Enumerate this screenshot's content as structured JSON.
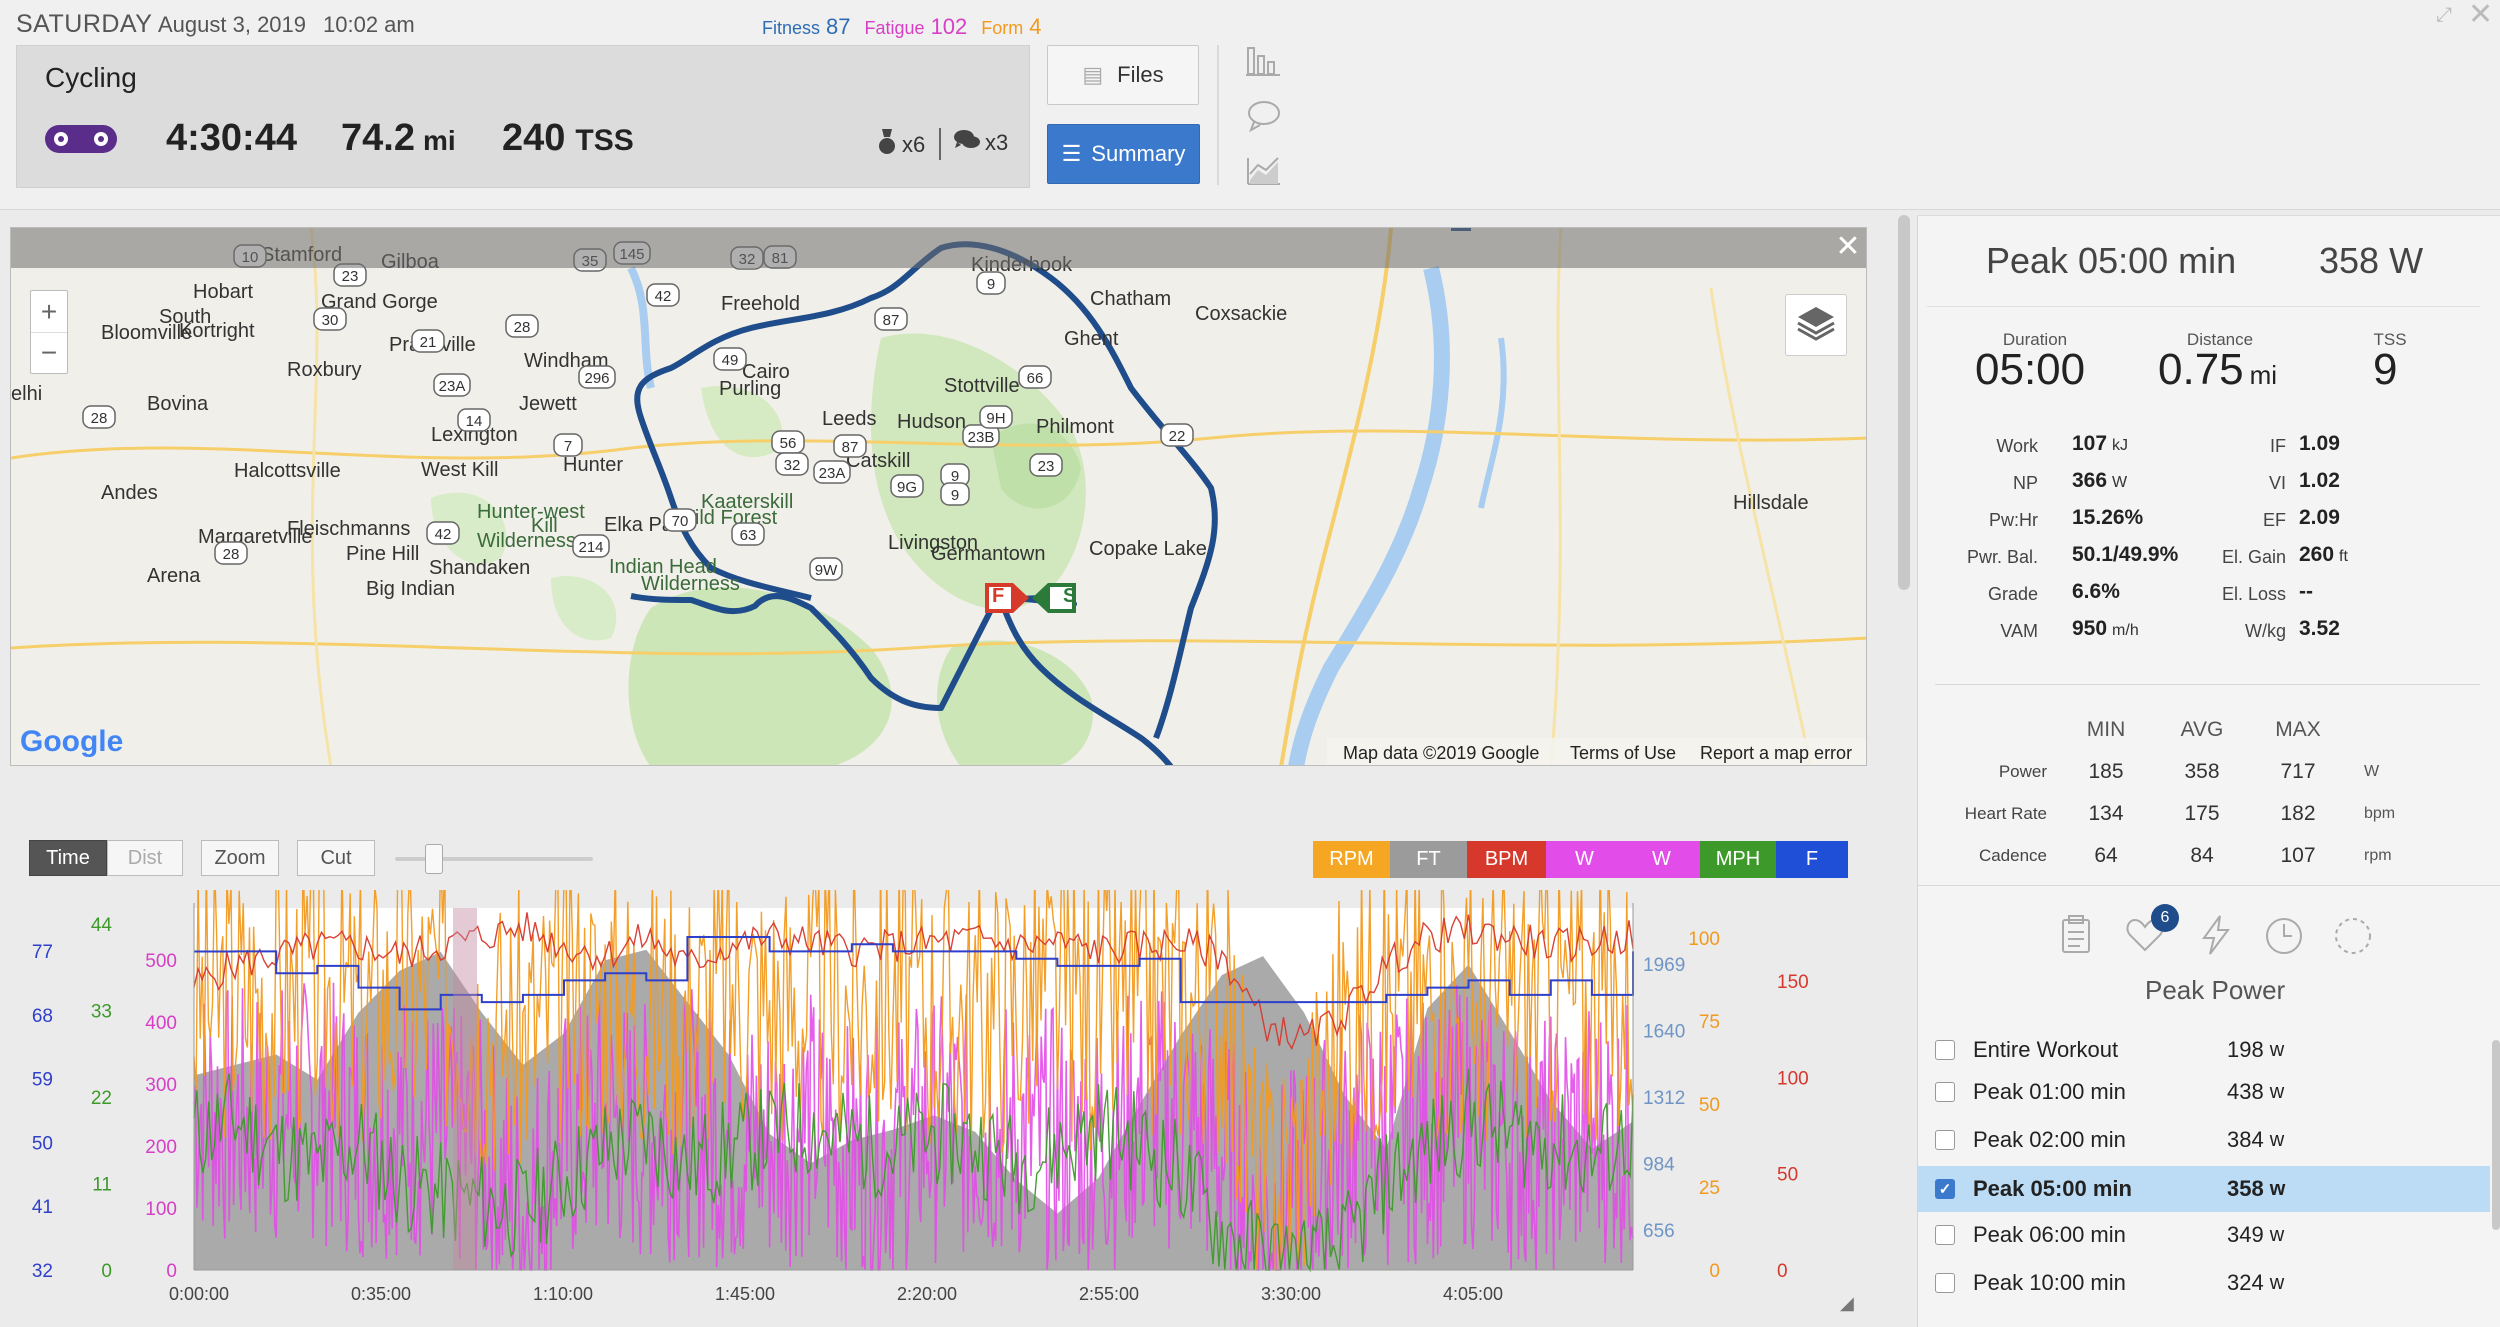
{
  "header": {
    "day": "SATURDAY",
    "date": "August 3, 2019",
    "time": "10:02 am",
    "metrics": [
      {
        "label": "Fitness",
        "value": "87",
        "color": "#2e6db5"
      },
      {
        "label": "Fatigue",
        "value": "102",
        "color": "#d63fc6"
      },
      {
        "label": "Form",
        "value": "4",
        "color": "#f29a1e"
      }
    ]
  },
  "workout": {
    "type": "Cycling",
    "duration": "4:30:44",
    "distance": "74.2",
    "distance_unit": "mi",
    "tss": "240",
    "tss_unit": "TSS",
    "badge_count": "x6",
    "comment_count": "x3"
  },
  "buttons": {
    "files": "Files",
    "summary": "Summary"
  },
  "map": {
    "labels": [
      {
        "t": "Stamford",
        "green": false
      },
      {
        "t": "Gilboa",
        "green": false
      },
      {
        "t": "Kinderhook",
        "green": false
      },
      {
        "t": "Hobart",
        "green": false
      },
      {
        "t": "Grand Gorge",
        "green": false
      },
      {
        "t": "Freehold",
        "green": false
      },
      {
        "t": "Chatham",
        "green": false
      },
      {
        "t": "Coxsackie",
        "green": false
      },
      {
        "t": "South",
        "green": false
      },
      {
        "t": "Kortright",
        "green": false
      },
      {
        "t": "Bloomville",
        "green": false
      },
      {
        "t": "Prattsville",
        "green": false
      },
      {
        "t": "Ghent",
        "green": false
      },
      {
        "t": "Windham",
        "green": false
      },
      {
        "t": "Cairo",
        "green": false
      },
      {
        "t": "Roxbury",
        "green": false
      },
      {
        "t": "Purling",
        "green": false
      },
      {
        "t": "Stottville",
        "green": false
      },
      {
        "t": "elhi",
        "green": false
      },
      {
        "t": "Bovina",
        "green": false
      },
      {
        "t": "Jewett",
        "green": false
      },
      {
        "t": "Leeds",
        "green": false
      },
      {
        "t": "Hudson",
        "green": false
      },
      {
        "t": "Philmont",
        "green": false
      },
      {
        "t": "Lexington",
        "green": false
      },
      {
        "t": "Catskill",
        "green": false
      },
      {
        "t": "Hunter",
        "green": false
      },
      {
        "t": "Halcottsville",
        "green": false
      },
      {
        "t": "West Kill",
        "green": false
      },
      {
        "t": "Andes",
        "green": false
      },
      {
        "t": "Kaaterskill",
        "green": true
      },
      {
        "t": "Wild Forest",
        "green": true
      },
      {
        "t": "Hillsdale",
        "green": false
      },
      {
        "t": "Hunter-west",
        "green": true
      },
      {
        "t": "Kill",
        "green": true
      },
      {
        "t": "Wilderness",
        "green": true
      },
      {
        "t": "Elka Park",
        "green": false
      },
      {
        "t": "Fleischmanns",
        "green": false
      },
      {
        "t": "Margaretville",
        "green": false
      },
      {
        "t": "Livingston",
        "green": false
      },
      {
        "t": "Copake Lake",
        "green": false
      },
      {
        "t": "Pine Hill",
        "green": false
      },
      {
        "t": "Germantown",
        "green": false
      },
      {
        "t": "Shandaken",
        "green": false
      },
      {
        "t": "Indian Head",
        "green": true
      },
      {
        "t": "Wilderness",
        "green": true
      },
      {
        "t": "Arena",
        "green": false
      },
      {
        "t": "Big Indian",
        "green": false
      }
    ],
    "shields": [
      "10",
      "23",
      "35",
      "145",
      "32",
      "81",
      "42",
      "9",
      "30",
      "28",
      "87",
      "21",
      "49",
      "296",
      "23A",
      "66",
      "14",
      "7",
      "56",
      "32",
      "87",
      "23B",
      "9H",
      "22",
      "28",
      "9",
      "23A",
      "9G",
      "9",
      "23",
      "42",
      "63",
      "214",
      "28",
      "9W",
      "70"
    ],
    "markers": {
      "finish": "F",
      "start": "S"
    },
    "attribution": "Map data ©2019 Google",
    "terms": "Terms of Use",
    "report": "Report a map error",
    "logo": "Google"
  },
  "chart_toolbar": {
    "time": "Time",
    "dist": "Dist",
    "zoom": "Zoom",
    "cut": "Cut",
    "series_buttons": [
      {
        "label": "RPM",
        "color": "#f5a623"
      },
      {
        "label": "FT",
        "color": "#9b9b9b"
      },
      {
        "label": "BPM",
        "color": "#d6382c"
      },
      {
        "label": "W",
        "color": "#e24ce8"
      },
      {
        "label": "W",
        "color": "#e24ce8"
      },
      {
        "label": "MPH",
        "color": "#3d9a2a"
      },
      {
        "label": "F",
        "color": "#1e4fd6"
      }
    ]
  },
  "chart_data": {
    "type": "line",
    "x_ticks": [
      "0:00:00",
      "0:35:00",
      "1:10:00",
      "1:45:00",
      "2:20:00",
      "2:55:00",
      "3:30:00",
      "4:05:00"
    ],
    "axes": {
      "speed_f": {
        "ticks": [
          "77",
          "68",
          "59",
          "50",
          "41",
          "32"
        ],
        "color": "#2e3fc9"
      },
      "mph": {
        "ticks": [
          "44",
          "33",
          "22",
          "11",
          "0"
        ],
        "color": "#3d9a2a"
      },
      "watts": {
        "ticks": [
          "500",
          "400",
          "300",
          "200",
          "100",
          "0"
        ],
        "color": "#d63fc6"
      },
      "elevation_ft": {
        "ticks": [
          "1969",
          "1640",
          "1312",
          "984",
          "656"
        ],
        "color": "#6f95c6"
      },
      "rpm": {
        "ticks": [
          "100",
          "75",
          "50",
          "25",
          "0"
        ],
        "color": "#f29a1e"
      },
      "bpm": {
        "ticks": [
          "150",
          "100",
          "50",
          "0"
        ],
        "color": "#d6382c"
      }
    },
    "series": [
      {
        "name": "FT",
        "color": "#9b9b9b",
        "values": [
          1400,
          1450,
          1500,
          1380,
          1700,
          1900,
          1990,
          1700,
          1450,
          1600,
          1950,
          2000,
          1750,
          1500,
          1120,
          980,
          1090,
          1140,
          1210,
          1130,
          900,
          740,
          910,
          1260,
          1590,
          1880,
          1970,
          1700,
          1300,
          1050,
          1720,
          1930,
          1610,
          1280,
          1050,
          1180
        ]
      },
      {
        "name": "W",
        "color": "#e24ce8",
        "values": [
          260,
          230,
          240,
          250,
          220,
          230,
          210,
          180,
          90,
          200,
          230,
          210,
          230,
          200,
          200,
          230,
          170,
          190,
          220,
          220,
          210,
          200,
          190,
          240,
          230,
          180,
          70,
          120,
          200,
          210,
          220,
          240,
          200,
          190,
          220,
          210
        ]
      },
      {
        "name": "BPM",
        "color": "#d6382c",
        "values": [
          150,
          160,
          165,
          170,
          170,
          165,
          170,
          175,
          180,
          170,
          165,
          175,
          160,
          170,
          175,
          172,
          168,
          170,
          172,
          174,
          170,
          172,
          168,
          170,
          172,
          165,
          130,
          120,
          135,
          160,
          175,
          178,
          175,
          170,
          172,
          175
        ]
      },
      {
        "name": "RPM",
        "color": "#f29a1e",
        "values": [
          80,
          85,
          82,
          88,
          78,
          84,
          86,
          75,
          72,
          82,
          84,
          80,
          78,
          86,
          82,
          80,
          82,
          84,
          80,
          78,
          82,
          85,
          80,
          82,
          84,
          80,
          20,
          40,
          78,
          82,
          84,
          80,
          82,
          86,
          80,
          84
        ]
      },
      {
        "name": "MPH",
        "color": "#3d9a2a",
        "values": [
          18,
          20,
          16,
          14,
          17,
          12,
          10,
          9,
          8,
          12,
          16,
          18,
          14,
          16,
          18,
          19,
          17,
          16,
          18,
          17,
          14,
          16,
          19,
          17,
          13,
          5,
          2,
          1,
          3,
          12,
          16,
          20,
          18,
          17,
          15,
          18
        ]
      },
      {
        "name": "F",
        "color": "#2e3fc9",
        "values": [
          74,
          74,
          71,
          72,
          69,
          66,
          68,
          67,
          68,
          70,
          71,
          70,
          76,
          76,
          74,
          74,
          75,
          74,
          74,
          74,
          73,
          72,
          72,
          73,
          67,
          67,
          67,
          67,
          67,
          68,
          69,
          70,
          68,
          70,
          68,
          74
        ]
      }
    ]
  },
  "right_panel": {
    "peak_title": "Peak 05:00 min",
    "peak_value": "358 W",
    "duration": {
      "label": "Duration",
      "value": "05:00"
    },
    "distance": {
      "label": "Distance",
      "value": "0.75",
      "unit": "mi"
    },
    "tss": {
      "label": "TSS",
      "value": "9"
    },
    "left_stats": [
      {
        "label": "Work",
        "value": "107",
        "unit": "kJ"
      },
      {
        "label": "NP",
        "value": "366",
        "unit": "W"
      },
      {
        "label": "Pw:Hr",
        "value": "15.26%",
        "unit": ""
      },
      {
        "label": "Pwr. Bal.",
        "value": "50.1/49.9%",
        "unit": ""
      },
      {
        "label": "Grade",
        "value": "6.6%",
        "unit": ""
      },
      {
        "label": "VAM",
        "value": "950",
        "unit": "m/h"
      }
    ],
    "right_stats": [
      {
        "label": "IF",
        "value": "1.09",
        "unit": ""
      },
      {
        "label": "VI",
        "value": "1.02",
        "unit": ""
      },
      {
        "label": "EF",
        "value": "2.09",
        "unit": ""
      },
      {
        "label": "El. Gain",
        "value": "260",
        "unit": "ft"
      },
      {
        "label": "El. Loss",
        "value": "--",
        "unit": ""
      },
      {
        "label": "W/kg",
        "value": "3.52",
        "unit": ""
      }
    ],
    "minmax": {
      "headers": [
        "MIN",
        "AVG",
        "MAX"
      ],
      "rows": [
        {
          "label": "Power",
          "min": "185",
          "avg": "358",
          "max": "717",
          "unit": "W"
        },
        {
          "label": "Heart Rate",
          "min": "134",
          "avg": "175",
          "max": "182",
          "unit": "bpm"
        },
        {
          "label": "Cadence",
          "min": "64",
          "avg": "84",
          "max": "107",
          "unit": "rpm"
        }
      ]
    },
    "badge_count": "6",
    "section_title": "Peak Power",
    "peaks": [
      {
        "name": "Entire Workout",
        "value": "198",
        "unit": "w",
        "selected": false
      },
      {
        "name": "Peak 01:00 min",
        "value": "438",
        "unit": "w",
        "selected": false
      },
      {
        "name": "Peak 02:00 min",
        "value": "384",
        "unit": "w",
        "selected": false
      },
      {
        "name": "Peak 05:00 min",
        "value": "358",
        "unit": "w",
        "selected": true
      },
      {
        "name": "Peak 06:00 min",
        "value": "349",
        "unit": "w",
        "selected": false
      },
      {
        "name": "Peak 10:00 min",
        "value": "324",
        "unit": "w",
        "selected": false
      }
    ]
  }
}
